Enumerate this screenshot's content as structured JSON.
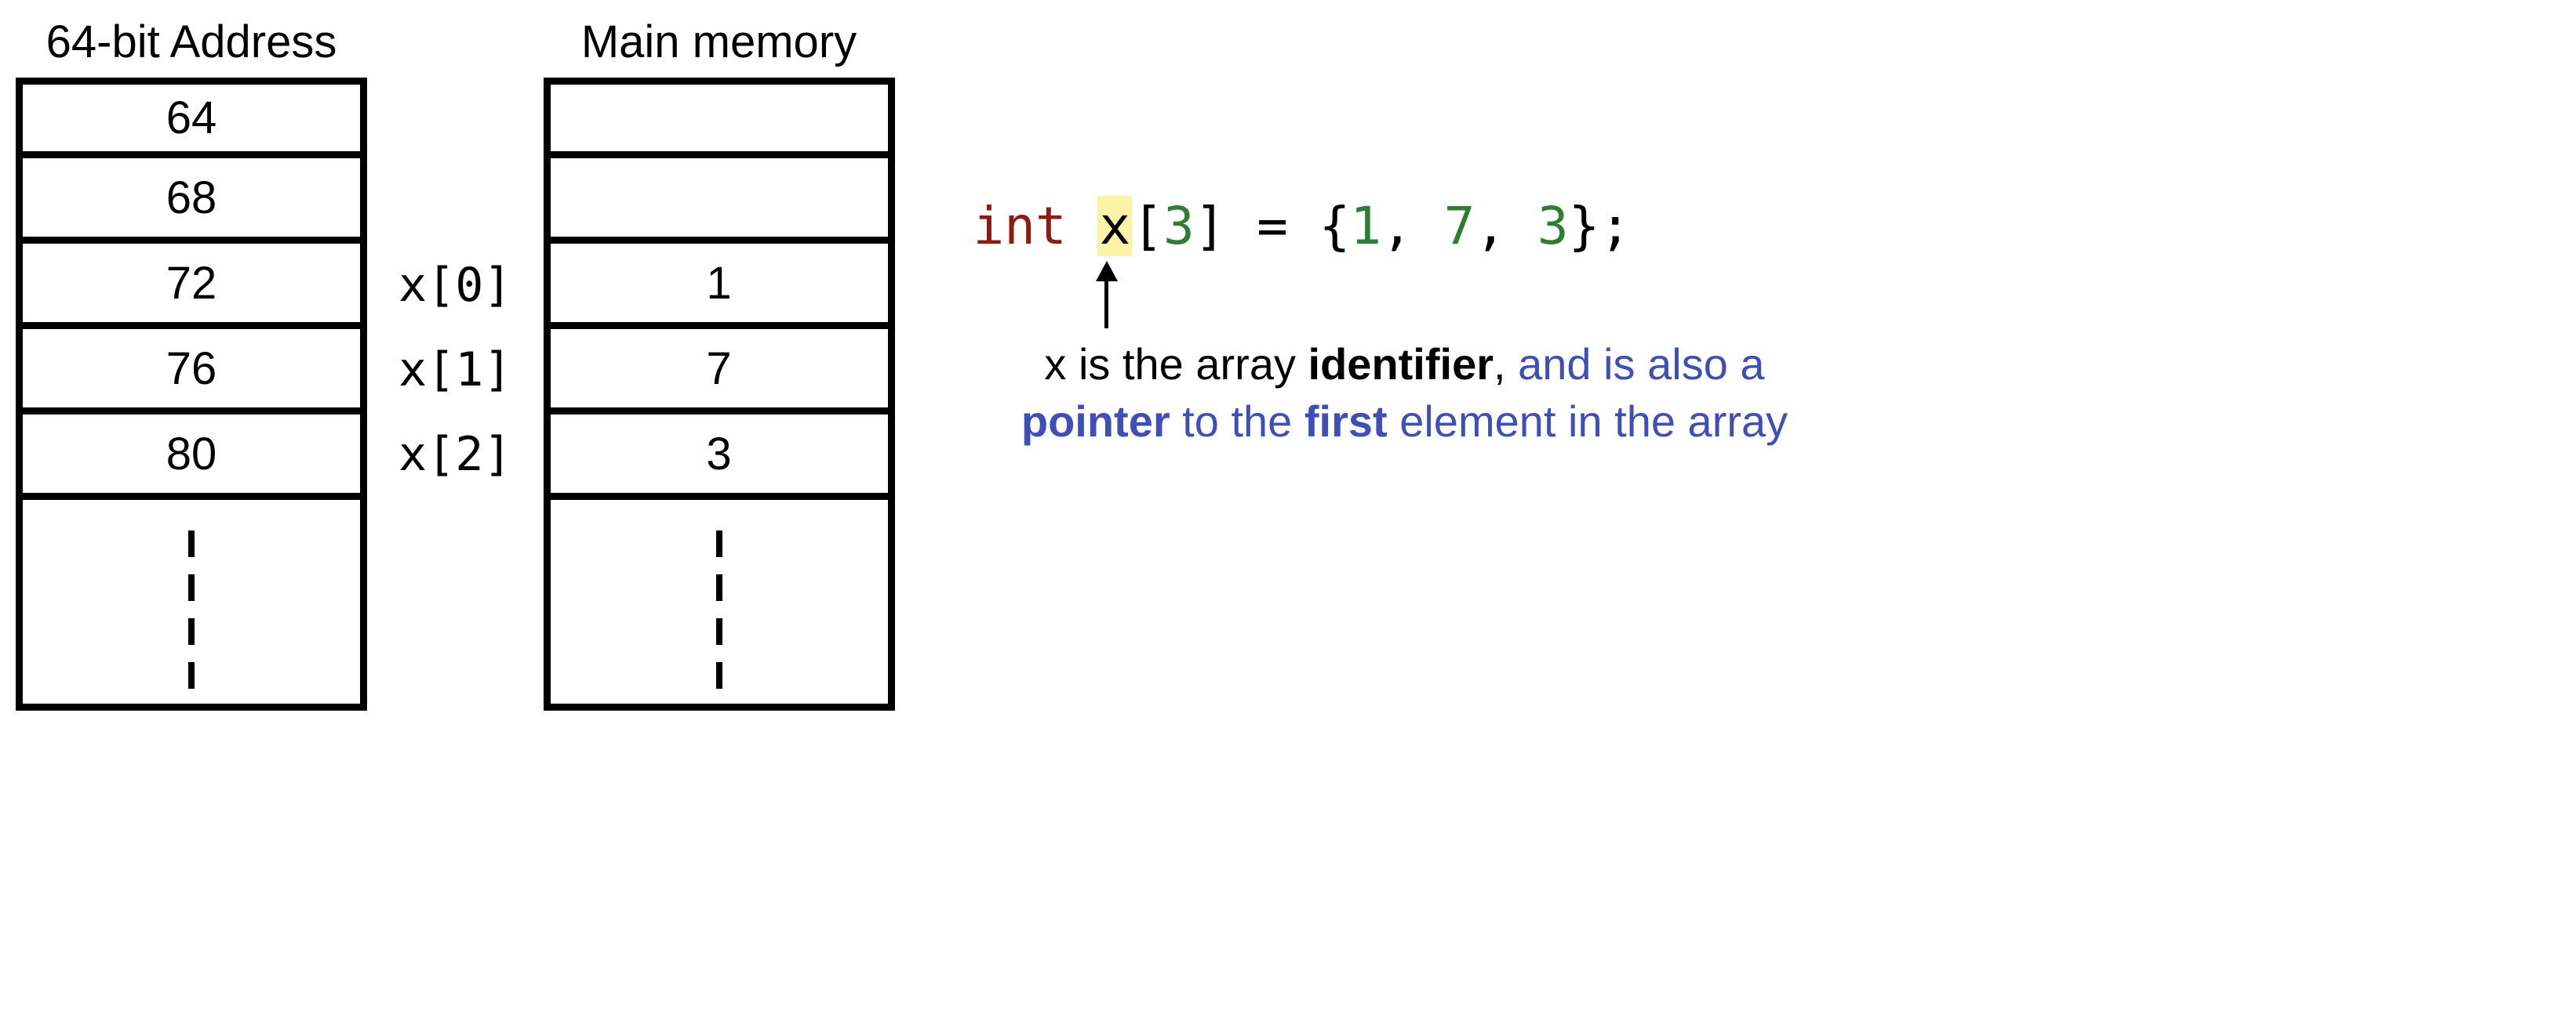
{
  "address_col": {
    "title": "64-bit Address",
    "cells": [
      "64",
      "68",
      "72",
      "76",
      "80"
    ]
  },
  "index_labels": [
    "x[0]",
    "x[1]",
    "x[2]"
  ],
  "memory_col": {
    "title": "Main memory",
    "cells": [
      "",
      "",
      "1",
      "7",
      "3"
    ]
  },
  "code": {
    "type_kw": "int",
    "var": "x",
    "size": "3",
    "vals": [
      "1",
      "7",
      "3"
    ]
  },
  "caption": {
    "t1": "x is the array ",
    "t2_bold": "identifier",
    "t3": ", ",
    "t4_blue": "and is also a ",
    "t5_blue_bold": "pointer",
    "t6_blue": " to the ",
    "t7_blue_bold": "first",
    "t8_blue": " element in the array"
  }
}
